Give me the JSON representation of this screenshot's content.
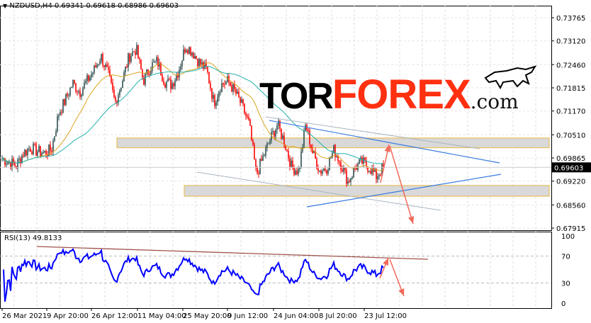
{
  "header": {
    "symbol": "NZDUSD,H4",
    "ohlc": "0.69341 0.69618 0.68986 0.69603"
  },
  "rsi": {
    "label": "RSI(13) 49.8133",
    "levels": [
      "100",
      "70",
      "30",
      "0"
    ]
  },
  "logo": {
    "text_dark": "TOR",
    "text_red": "FOREX",
    "suffix": ".com"
  },
  "colors": {
    "bull": "#2f4f4f",
    "bear": "#ff0000",
    "ma_fast": "#daa520",
    "ma_slow": "#20b2aa",
    "rsi": "#0000ff",
    "trend": "#3a7be0",
    "arrow": "#f26b5b",
    "current_bg": "#000000"
  },
  "chart_data": {
    "type": "candlestick",
    "title": "NZDUSD,H4",
    "current_price": "0.69603",
    "price_ticks": [
      "0.73765",
      "0.73120",
      "0.72460",
      "0.71815",
      "0.71170",
      "0.70510",
      "0.69865",
      "0.69220",
      "0.68560",
      "0.67915"
    ],
    "ylim": [
      0.67915,
      0.73765
    ],
    "time_ticks": [
      "26 Mar 2021",
      "9 Apr 20:00",
      "26 Apr 12:00",
      "11 May 04:00",
      "25 May 20:00",
      "9 Jun 12:00",
      "24 Jun 04:00",
      "8 Jul 20:00",
      "23 Jul 12:00"
    ],
    "approx_closes": [
      0.6985,
      0.6975,
      0.6965,
      0.7,
      0.7015,
      0.7005,
      0.7,
      0.701,
      0.711,
      0.715,
      0.7195,
      0.717,
      0.72,
      0.723,
      0.727,
      0.722,
      0.714,
      0.72,
      0.727,
      0.729,
      0.72,
      0.724,
      0.7255,
      0.72,
      0.719,
      0.723,
      0.73,
      0.728,
      0.725,
      0.723,
      0.714,
      0.719,
      0.72,
      0.717,
      0.713,
      0.708,
      0.694,
      0.699,
      0.704,
      0.708,
      0.703,
      0.696,
      0.695,
      0.708,
      0.7,
      0.695,
      0.696,
      0.701,
      0.697,
      0.692,
      0.696,
      0.6975,
      0.696,
      0.6935,
      0.696
    ],
    "zones": [
      [
        0.7015,
        0.7042
      ],
      [
        0.688,
        0.691
      ]
    ],
    "rsi_period": 13
  }
}
